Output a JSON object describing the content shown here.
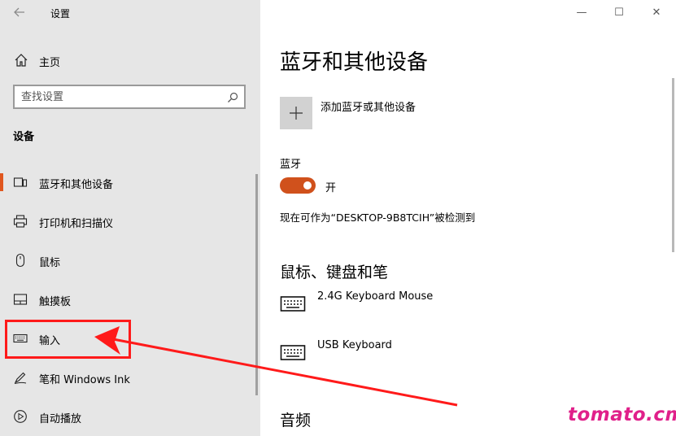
{
  "app": {
    "title": "设置",
    "back_icon": "back-arrow-icon"
  },
  "sidebar": {
    "home_label": "主页",
    "search_placeholder": "查找设置",
    "section": "设备",
    "items": [
      {
        "label": "蓝牙和其他设备",
        "icon": "bluetooth-devices-icon",
        "selected": true
      },
      {
        "label": "打印机和扫描仪",
        "icon": "printer-icon",
        "selected": false
      },
      {
        "label": "鼠标",
        "icon": "mouse-icon",
        "selected": false
      },
      {
        "label": "触摸板",
        "icon": "touchpad-icon",
        "selected": false
      },
      {
        "label": "输入",
        "icon": "keyboard-icon",
        "selected": false
      },
      {
        "label": "笔和 Windows Ink",
        "icon": "pen-icon",
        "selected": false
      },
      {
        "label": "自动播放",
        "icon": "autoplay-icon",
        "selected": false
      }
    ]
  },
  "window_controls": {
    "minimize": "—",
    "maximize": "☐",
    "close": "✕"
  },
  "main": {
    "title": "蓝牙和其他设备",
    "add_label": "添加蓝牙或其他设备",
    "bluetooth_label": "蓝牙",
    "toggle_state": "开",
    "discoverable_text": "现在可作为“DESKTOP-9B8TCIH”被检测到",
    "section_input_title": "鼠标、键盘和笔",
    "devices": [
      {
        "name": "2.4G Keyboard Mouse",
        "icon": "keyboard-icon"
      },
      {
        "name": "USB Keyboard",
        "icon": "keyboard-icon"
      }
    ],
    "section_audio_title": "音频"
  },
  "overlay": {
    "watermark": "tomato.cm"
  },
  "colors": {
    "accent": "#d0511c",
    "sidebar_bg": "#e6e6e6",
    "annotation": "#ff1a1a",
    "watermark": "#e0208a"
  }
}
